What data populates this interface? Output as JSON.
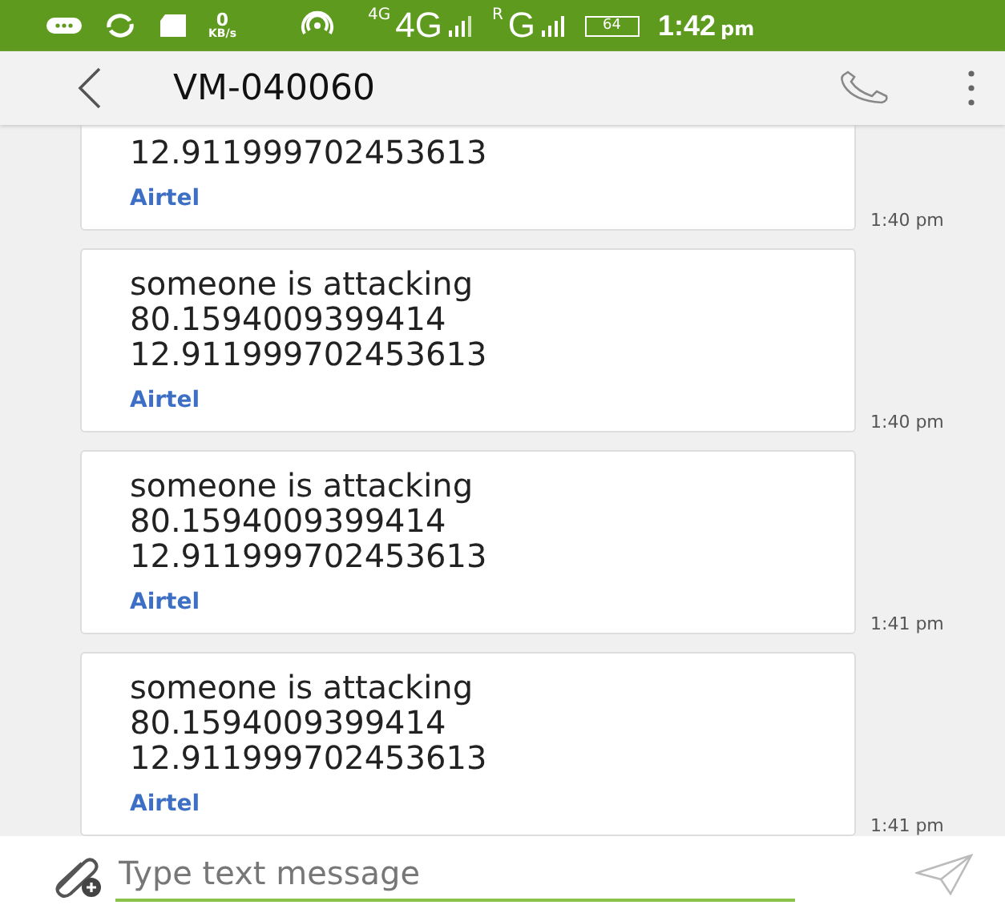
{
  "status_bar": {
    "speed_value": "0",
    "speed_unit": "KB/s",
    "network_1_small": "4G",
    "network_1": "4G",
    "network_2_small": "R",
    "network_2": "G",
    "battery": "64",
    "time": "1:42",
    "time_suffix": "pm"
  },
  "header": {
    "title": "VM-040060"
  },
  "messages": [
    {
      "text": "12.911999702453613",
      "sender": "Airtel",
      "time": "1:40 pm"
    },
    {
      "text": "someone is attacking\n80.1594009399414\n12.911999702453613",
      "sender": "Airtel",
      "time": "1:40 pm"
    },
    {
      "text": "someone is attacking\n80.1594009399414\n12.911999702453613",
      "sender": "Airtel",
      "time": "1:41 pm"
    },
    {
      "text": "someone is attacking\n80.1594009399414\n12.911999702453613",
      "sender": "Airtel",
      "time": "1:41 pm"
    }
  ],
  "composer": {
    "placeholder": "Type text message"
  }
}
